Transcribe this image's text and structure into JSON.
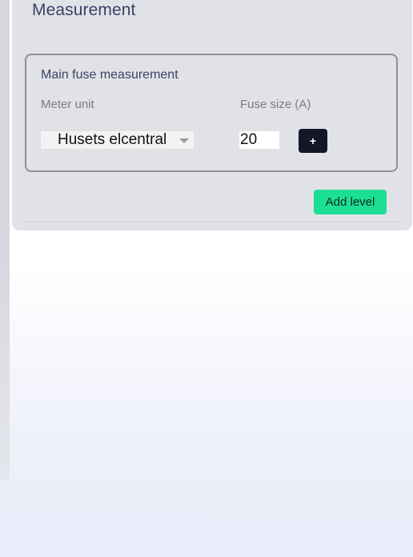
{
  "measurement": {
    "title": "Measurement",
    "main_fuse": {
      "title": "Main fuse measurement",
      "meter_unit_label": "Meter unit",
      "meter_unit_value": "Husets elcentral",
      "fuse_size_label": "Fuse size (A)",
      "fuse_size_value": "20",
      "add_button_label": "+"
    },
    "add_level_label": "Add level"
  }
}
